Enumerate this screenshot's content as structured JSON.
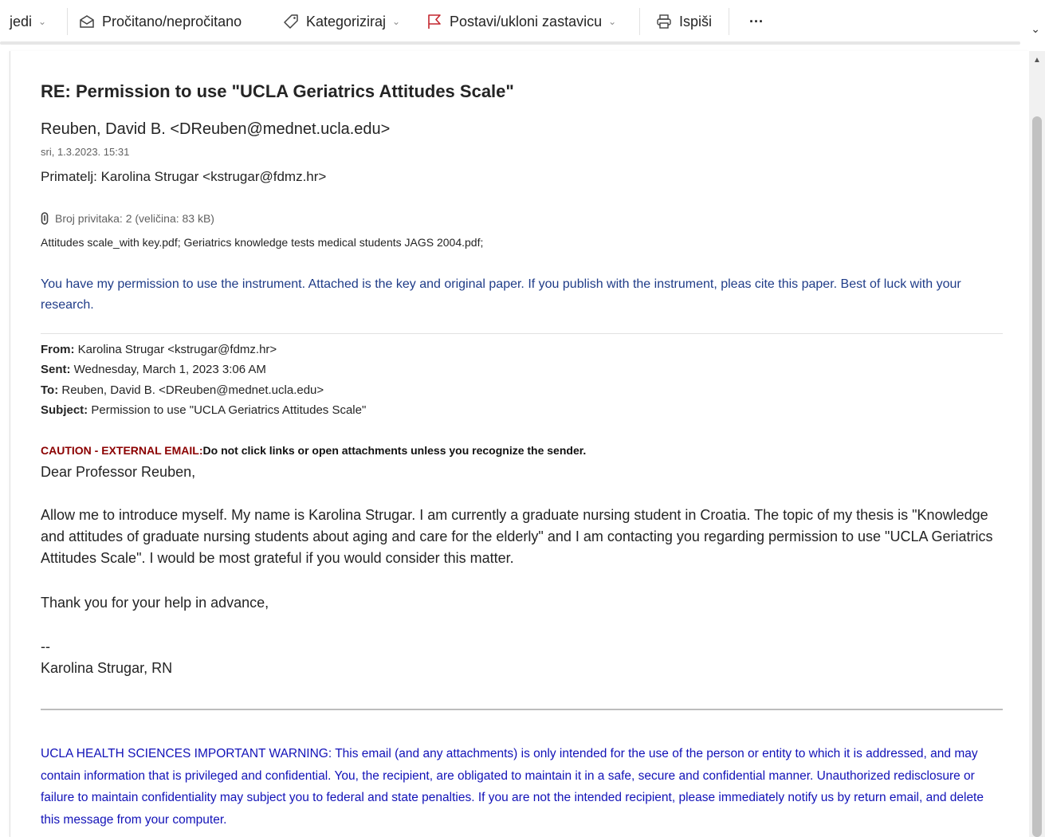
{
  "toolbar": {
    "first_label": "jedi",
    "read_unread": "Pročitano/nepročitano",
    "categorize": "Kategoriziraj",
    "flag": "Postavi/ukloni zastavicu",
    "print": "Ispiši",
    "more": "···",
    "flag_color": "#c4262e"
  },
  "email": {
    "subject": "RE: Permission to use \"UCLA Geriatrics Attitudes Scale\"",
    "sender": "Reuben, David B. <DReuben@mednet.ucla.edu>",
    "date": "sri, 1.3.2023. 15:31",
    "recipient": "Primatelj: Karolina Strugar <kstrugar@fdmz.hr>",
    "attachments_summary": "Broj privitaka: 2 (veličina: 83 kB)",
    "attachment_files": "Attitudes scale_with key.pdf; Geriatrics knowledge tests medical students JAGS 2004.pdf;",
    "reply_text": "You have my permission to use the instrument. Attached is the key and original paper. If you publish with the instrument, pleas cite this paper. Best of luck with your research.",
    "quoted": {
      "from_label": "From:",
      "from_value": " Karolina Strugar <kstrugar@fdmz.hr>",
      "sent_label": "Sent:",
      "sent_value": " Wednesday, March 1, 2023 3:06 AM",
      "to_label": "To:",
      "to_value": " Reuben, David B. <DReuben@mednet.ucla.edu>",
      "subject_label": "Subject:",
      "subject_value": " Permission to use \"UCLA Geriatrics Attitudes Scale\""
    },
    "caution_label": "CAUTION - EXTERNAL EMAIL:",
    "caution_text": "Do not click links or open attachments unless you recognize the sender.",
    "greeting": "Dear Professor Reuben,",
    "paragraph": "Allow me to introduce myself. My name is Karolina Strugar. I am currently a graduate nursing student in Croatia. The topic of my thesis is \"Knowledge and attitudes of graduate nursing students about aging and care for the elderly\" and I am contacting you regarding permission to use \"UCLA Geriatrics Attitudes Scale\". I would be most grateful if you would consider this matter.",
    "thanks": "Thank you for your help in advance,",
    "sig_dash": "--",
    "signature": "Karolina Strugar, RN",
    "warning": "UCLA HEALTH SCIENCES IMPORTANT WARNING: This email (and any attachments) is only intended for the use of the person or entity to which it is addressed, and may contain information that is privileged and confidential. You, the recipient, are obligated to maintain it in a safe, secure and confidential manner. Unauthorized redisclosure or failure to maintain confidentiality may subject you to federal and state penalties. If you are not the intended recipient, please immediately notify us by return email, and delete this message from your computer."
  }
}
